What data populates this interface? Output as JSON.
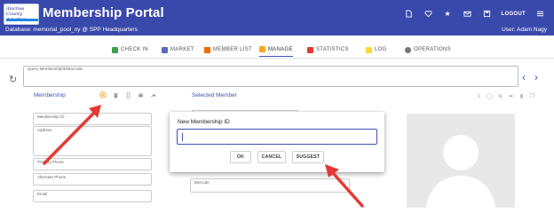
{
  "header": {
    "title": "Membership Portal",
    "logo_text": "Alachua County Aquatics",
    "database_line": "Database: memorial_pool_ny @ SPP Headquarters",
    "user_line": "User: Adam Nagy",
    "logout_label": "LOGOUT",
    "background": "#3949ab"
  },
  "tabs": [
    {
      "label": "CHECK IN",
      "icon": "check-icon",
      "color": "#43a047"
    },
    {
      "label": "MARKET",
      "icon": "cart-icon",
      "color": "#5c6bc0"
    },
    {
      "label": "MEMBER LIST",
      "icon": "list-icon",
      "color": "#ef6c00"
    },
    {
      "label": "MANAGE",
      "icon": "edit-icon",
      "color": "#f9a825",
      "active": true
    },
    {
      "label": "STATISTICS",
      "icon": "chart-icon",
      "color": "#e53935"
    },
    {
      "label": "LOG",
      "icon": "note-icon",
      "color": "#fdd835"
    },
    {
      "label": "OPERATIONS",
      "icon": "gear-icon",
      "color": "#757575"
    }
  ],
  "query": {
    "label": "Query Membership/ID/Barcode"
  },
  "membership": {
    "title": "Membership",
    "fields": {
      "id": "Membership ID",
      "address": "Address",
      "phone": "Primary Phone",
      "alt_phone": "Alternate Phone",
      "email": "Email"
    }
  },
  "selected_member": {
    "title": "Selected Member",
    "fields": {
      "member": "Member",
      "barcode": "Barcode"
    }
  },
  "dialog": {
    "title": "New Membership ID",
    "input_value": "",
    "ok_label": "OK",
    "cancel_label": "CANCEL",
    "suggest_label": "SUGGEST"
  },
  "annotation_color": "#e53935"
}
